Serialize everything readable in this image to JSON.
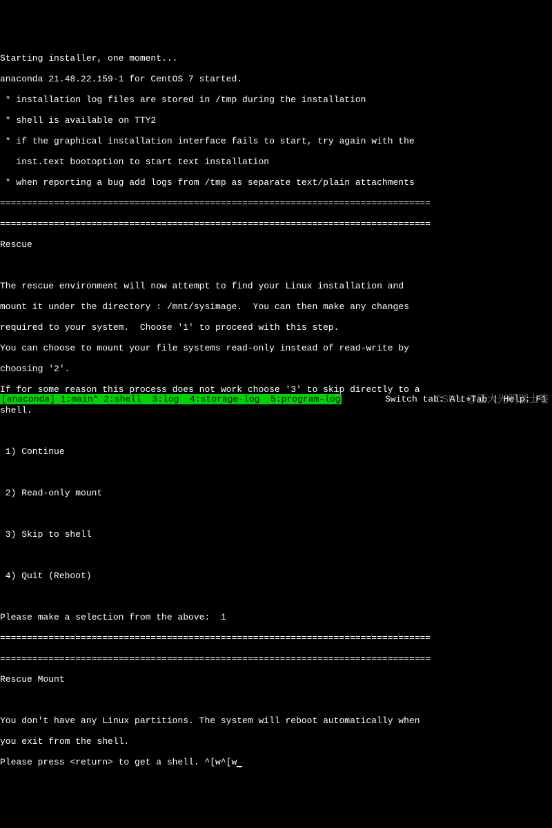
{
  "header": {
    "line1": "Starting installer, one moment...",
    "line2": "anaconda 21.48.22.159-1 for CentOS 7 started.",
    "bullet1": " * installation log files are stored in /tmp during the installation",
    "bullet2": " * shell is available on TTY2",
    "bullet3": " * if the graphical installation interface fails to start, try again with the",
    "bullet3b": "   inst.text bootoption to start text installation",
    "bullet4": " * when reporting a bug add logs from /tmp as separate text/plain attachments"
  },
  "separator": "================================================================================",
  "rescue": {
    "title": "Rescue",
    "para1a": "The rescue environment will now attempt to find your Linux installation and",
    "para1b": "mount it under the directory : /mnt/sysimage.  You can then make any changes",
    "para1c": "required to your system.  Choose '1' to proceed with this step.",
    "para2a": "You can choose to mount your file systems read-only instead of read-write by",
    "para2b": "choosing '2'.",
    "para3a": "If for some reason this process does not work choose '3' to skip directly to a",
    "para3b": "shell."
  },
  "options": {
    "opt1": " 1) Continue",
    "opt2": " 2) Read-only mount",
    "opt3": " 3) Skip to shell",
    "opt4": " 4) Quit (Reboot)"
  },
  "prompt": {
    "label": "Please make a selection from the above:  ",
    "value": "1"
  },
  "mount": {
    "title": "Rescue Mount",
    "msg1": "You don't have any Linux partitions. The system will reboot automatically when",
    "msg2": "you exit from the shell.",
    "msg3": "Please press <return> to get a shell. ^[w^[w"
  },
  "footer": {
    "left": "[anaconda] 1:main* 2:shell  3:log  4:storage-log  5:program-log",
    "right": "Switch tab: Alt+Tab | Help: F1"
  },
  "watermark": "CSDN @正大光明瑞士卷"
}
